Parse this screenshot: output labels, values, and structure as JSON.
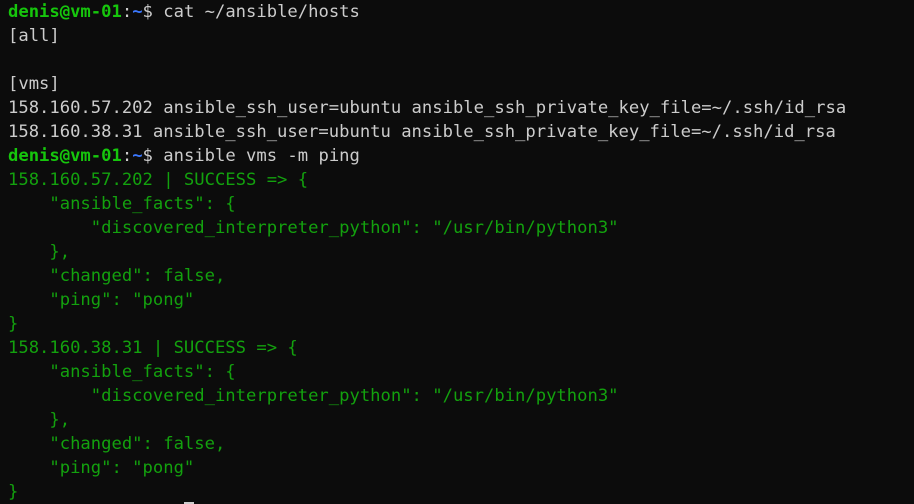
{
  "prompt": {
    "user_host": "denis@vm-01",
    "colon": ":",
    "cwd": "~",
    "symbol": "$ "
  },
  "session": {
    "cmd1": "cat ~/ansible/hosts",
    "hosts_all": "[all]",
    "hosts_blank": "",
    "hosts_vms": "[vms]",
    "hosts_line1": "158.160.57.202 ansible_ssh_user=ubuntu ansible_ssh_private_key_file=~/.ssh/id_rsa",
    "hosts_line2": "158.160.38.31 ansible_ssh_user=ubuntu ansible_ssh_private_key_file=~/.ssh/id_rsa",
    "cmd2": "ansible vms -m ping",
    "r1_head": "158.160.57.202 | SUCCESS => {",
    "r1_facts_open": "    \"ansible_facts\": {",
    "r1_interp": "        \"discovered_interpreter_python\": \"/usr/bin/python3\"",
    "r1_facts_close": "    },",
    "r1_changed": "    \"changed\": false,",
    "r1_ping": "    \"ping\": \"pong\"",
    "r1_close": "}",
    "r2_head": "158.160.38.31 | SUCCESS => {",
    "r2_facts_open": "    \"ansible_facts\": {",
    "r2_interp": "        \"discovered_interpreter_python\": \"/usr/bin/python3\"",
    "r2_facts_close": "    },",
    "r2_changed": "    \"changed\": false,",
    "r2_ping": "    \"ping\": \"pong\"",
    "r2_close": "}"
  },
  "colors": {
    "background": "#0c0c0c",
    "text": "#cccccc",
    "prompt_user": "#16c60c",
    "prompt_path": "#3b78ff",
    "success_output": "#13a10e"
  }
}
